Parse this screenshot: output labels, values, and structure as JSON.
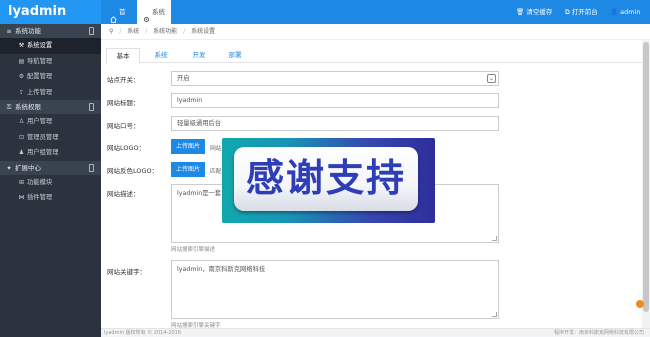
{
  "app": {
    "logo": "lyadmin"
  },
  "topbar": {
    "tabs": [
      {
        "label": "首页",
        "icon": "home-icon"
      },
      {
        "label": "系统",
        "icon": "cog-icon"
      }
    ],
    "right": {
      "clear_cache": "清空缓存",
      "open_front": "打开前台",
      "user": "admin"
    }
  },
  "sidebar": {
    "groups": [
      {
        "label": "系统功能",
        "items": [
          "系统设置",
          "导航管理",
          "配置管理",
          "上传管理"
        ]
      },
      {
        "label": "系统权限",
        "items": [
          "用户管理",
          "管理员管理",
          "用户组管理"
        ]
      },
      {
        "label": "扩展中心",
        "items": [
          "功能模块",
          "插件管理"
        ]
      }
    ],
    "active_item": "系统设置"
  },
  "breadcrumb": [
    "系统",
    "系统功能",
    "系统设置"
  ],
  "subtabs": [
    "基本",
    "系统",
    "开发",
    "部署"
  ],
  "form": {
    "site_switch": {
      "label": "站点开关：",
      "value": "开启"
    },
    "site_title": {
      "label": "网站标题：",
      "value": "lyadmin"
    },
    "site_slogan": {
      "label": "网站口号：",
      "value": "轻量级通用后台"
    },
    "site_logo": {
      "label": "网站LOGO：",
      "button": "上传图片",
      "text": "网站"
    },
    "site_logo_inverse": {
      "label": "网站反色LOGO：",
      "button": "上传图片",
      "text": "匹配"
    },
    "site_desc": {
      "label": "网站描述：",
      "value": "lyadmin是一套",
      "hint": "网站搜索引擎描述"
    },
    "site_keywords": {
      "label": "网站关键字：",
      "value": "lyadmin，南京科斯克网络科技",
      "hint": "网站搜索引擎关键字"
    }
  },
  "banner": {
    "text": "感谢支持"
  },
  "footer": {
    "left": "lyadmin 版权所有 © 2014-2016",
    "right": "程序开发：南京科斯克网络科技有限公司"
  }
}
